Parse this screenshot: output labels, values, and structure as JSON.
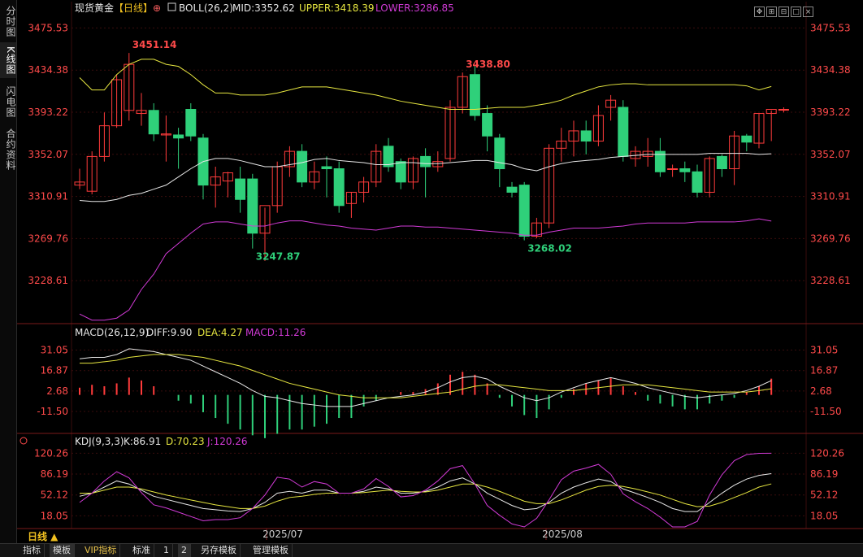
{
  "left_tabs": [
    {
      "label": "分时图",
      "active": false
    },
    {
      "label": "K线图",
      "active": true
    },
    {
      "label": "闪电图",
      "active": false
    },
    {
      "label": "合约资料",
      "active": false
    }
  ],
  "header": {
    "title": "现货黄金",
    "period_tag": "【日线】",
    "add_icon": "⊕",
    "boll_label": "BOLL(26,2)",
    "mid_label": "MID:3352.62",
    "upper_label": "UPPER:3418.39",
    "lower_label": "LOWER:3286.85"
  },
  "macd_header": {
    "name": "MACD(26,12,9)",
    "diff": "DIFF:9.90",
    "dea": "DEA:4.27",
    "macd": "MACD:11.26"
  },
  "kdj_header": {
    "name": "KDJ(9,3,3)",
    "k": "K:86.91",
    "d": "D:70.23",
    "j": "J:120.26"
  },
  "bottom": {
    "period_label": "日线 ▲",
    "buttons": [
      "指标",
      "模板",
      "VIP指标",
      "标准",
      "1",
      "2",
      "另存模板",
      "管理模板"
    ]
  },
  "colors": {
    "up": "#ff3b3b",
    "down": "#2fd07a",
    "mid": "#e8e8e8",
    "upper": "#e6e640",
    "lower": "#d13ad6",
    "axis_text": "#ff4a4a",
    "grid": "#3a0d0d"
  },
  "chart_data": [
    {
      "type": "candlestick",
      "title": "现货黄金【日线】",
      "y_ticks": [
        "3475.53",
        "3434.38",
        "3393.22",
        "3352.07",
        "3310.91",
        "3269.76",
        "3228.61"
      ],
      "ylim": [
        3189,
        3487
      ],
      "x_labels": [
        "2025/07",
        "2025/08"
      ],
      "annotations": [
        {
          "text": "3451.14",
          "color": "#ff4a4a",
          "bar": 4
        },
        {
          "text": "3438.80",
          "color": "#ff4a4a",
          "bar": 31
        },
        {
          "text": "3247.87",
          "color": "#2fd07a",
          "bar": 14
        },
        {
          "text": "3268.02",
          "color": "#2fd07a",
          "bar": 36
        }
      ],
      "candles": [
        {
          "o": 3322,
          "h": 3338,
          "l": 3318,
          "c": 3325
        },
        {
          "o": 3316,
          "h": 3355,
          "l": 3313,
          "c": 3350
        },
        {
          "o": 3350,
          "h": 3393,
          "l": 3345,
          "c": 3380
        },
        {
          "o": 3380,
          "h": 3430,
          "l": 3378,
          "c": 3425
        },
        {
          "o": 3395,
          "h": 3451.14,
          "l": 3385,
          "c": 3440
        },
        {
          "o": 3392,
          "h": 3412,
          "l": 3380,
          "c": 3395
        },
        {
          "o": 3395,
          "h": 3402,
          "l": 3365,
          "c": 3372
        },
        {
          "o": 3371,
          "h": 3390,
          "l": 3345,
          "c": 3372
        },
        {
          "o": 3371,
          "h": 3378,
          "l": 3338,
          "c": 3368
        },
        {
          "o": 3396,
          "h": 3402,
          "l": 3365,
          "c": 3370
        },
        {
          "o": 3368,
          "h": 3372,
          "l": 3308,
          "c": 3322
        },
        {
          "o": 3322,
          "h": 3340,
          "l": 3300,
          "c": 3330
        },
        {
          "o": 3326,
          "h": 3335,
          "l": 3310,
          "c": 3334
        },
        {
          "o": 3328,
          "h": 3340,
          "l": 3295,
          "c": 3308
        },
        {
          "o": 3328,
          "h": 3333,
          "l": 3260,
          "c": 3275
        },
        {
          "o": 3275,
          "h": 3300,
          "l": 3247.87,
          "c": 3302
        },
        {
          "o": 3302,
          "h": 3345,
          "l": 3295,
          "c": 3340
        },
        {
          "o": 3340,
          "h": 3360,
          "l": 3330,
          "c": 3355
        },
        {
          "o": 3355,
          "h": 3362,
          "l": 3320,
          "c": 3325
        },
        {
          "o": 3325,
          "h": 3345,
          "l": 3318,
          "c": 3335
        },
        {
          "o": 3340,
          "h": 3350,
          "l": 3310,
          "c": 3338
        },
        {
          "o": 3338,
          "h": 3345,
          "l": 3295,
          "c": 3302
        },
        {
          "o": 3304,
          "h": 3315,
          "l": 3290,
          "c": 3315
        },
        {
          "o": 3315,
          "h": 3330,
          "l": 3305,
          "c": 3325
        },
        {
          "o": 3325,
          "h": 3362,
          "l": 3320,
          "c": 3355
        },
        {
          "o": 3360,
          "h": 3368,
          "l": 3335,
          "c": 3340
        },
        {
          "o": 3345,
          "h": 3348,
          "l": 3318,
          "c": 3325
        },
        {
          "o": 3325,
          "h": 3350,
          "l": 3318,
          "c": 3348
        },
        {
          "o": 3350,
          "h": 3358,
          "l": 3310,
          "c": 3340
        },
        {
          "o": 3340,
          "h": 3355,
          "l": 3335,
          "c": 3345
        },
        {
          "o": 3348,
          "h": 3405,
          "l": 3345,
          "c": 3398
        },
        {
          "o": 3398,
          "h": 3432,
          "l": 3392,
          "c": 3428
        },
        {
          "o": 3430,
          "h": 3438.8,
          "l": 3385,
          "c": 3390
        },
        {
          "o": 3392,
          "h": 3400,
          "l": 3355,
          "c": 3370
        },
        {
          "o": 3368,
          "h": 3372,
          "l": 3320,
          "c": 3338
        },
        {
          "o": 3320,
          "h": 3325,
          "l": 3310,
          "c": 3315
        },
        {
          "o": 3322,
          "h": 3325,
          "l": 3268.02,
          "c": 3272
        },
        {
          "o": 3272,
          "h": 3290,
          "l": 3270,
          "c": 3285
        },
        {
          "o": 3285,
          "h": 3362,
          "l": 3280,
          "c": 3358
        },
        {
          "o": 3358,
          "h": 3378,
          "l": 3345,
          "c": 3365
        },
        {
          "o": 3365,
          "h": 3385,
          "l": 3350,
          "c": 3375
        },
        {
          "o": 3375,
          "h": 3385,
          "l": 3352,
          "c": 3365
        },
        {
          "o": 3365,
          "h": 3400,
          "l": 3360,
          "c": 3390
        },
        {
          "o": 3398,
          "h": 3410,
          "l": 3385,
          "c": 3405
        },
        {
          "o": 3398,
          "h": 3405,
          "l": 3345,
          "c": 3350
        },
        {
          "o": 3348,
          "h": 3360,
          "l": 3340,
          "c": 3355
        },
        {
          "o": 3350,
          "h": 3368,
          "l": 3340,
          "c": 3355
        },
        {
          "o": 3355,
          "h": 3368,
          "l": 3330,
          "c": 3335
        },
        {
          "o": 3338,
          "h": 3342,
          "l": 3330,
          "c": 3338
        },
        {
          "o": 3338,
          "h": 3345,
          "l": 3325,
          "c": 3335
        },
        {
          "o": 3335,
          "h": 3342,
          "l": 3310,
          "c": 3315
        },
        {
          "o": 3315,
          "h": 3350,
          "l": 3310,
          "c": 3348
        },
        {
          "o": 3350,
          "h": 3352,
          "l": 3330,
          "c": 3338
        },
        {
          "o": 3338,
          "h": 3375,
          "l": 3322,
          "c": 3370
        },
        {
          "o": 3370,
          "h": 3372,
          "l": 3355,
          "c": 3364
        },
        {
          "o": 3363,
          "h": 3392,
          "l": 3358,
          "c": 3392
        },
        {
          "o": 3392,
          "h": 3395,
          "l": 3365,
          "c": 3396
        },
        {
          "o": 3396,
          "h": 3398,
          "l": 3393,
          "c": 3396
        }
      ],
      "series": [
        {
          "name": "MID",
          "values": [
            3307,
            3306,
            3306,
            3308,
            3312,
            3314,
            3318,
            3322,
            3330,
            3338,
            3345,
            3348,
            3348,
            3346,
            3343,
            3340,
            3340,
            3342,
            3344,
            3347,
            3348,
            3346,
            3345,
            3344,
            3342,
            3342,
            3344,
            3344,
            3343,
            3343,
            3344,
            3345,
            3346,
            3346,
            3344,
            3342,
            3338,
            3336,
            3340,
            3343,
            3345,
            3346,
            3347,
            3349,
            3350,
            3351,
            3352,
            3352,
            3352,
            3352,
            3352,
            3353,
            3353,
            3353,
            3353,
            3352,
            3352.62
          ]
        },
        {
          "name": "UPPER",
          "values": [
            3427,
            3415,
            3415,
            3430,
            3440,
            3445,
            3445,
            3440,
            3438,
            3430,
            3420,
            3412,
            3412,
            3410,
            3410,
            3410,
            3412,
            3415,
            3418,
            3418,
            3418,
            3416,
            3414,
            3412,
            3410,
            3407,
            3404,
            3402,
            3400,
            3398,
            3396,
            3396,
            3396,
            3397,
            3398,
            3398,
            3398,
            3400,
            3402,
            3405,
            3410,
            3414,
            3418,
            3420,
            3421,
            3421,
            3420,
            3420,
            3420,
            3420,
            3420,
            3420,
            3420,
            3420,
            3419,
            3415,
            3418.39
          ]
        },
        {
          "name": "LOWER",
          "values": [
            3196,
            3190,
            3190,
            3192,
            3200,
            3220,
            3235,
            3255,
            3265,
            3275,
            3284,
            3286,
            3286,
            3284,
            3282,
            3282,
            3285,
            3287,
            3287,
            3285,
            3283,
            3282,
            3280,
            3279,
            3278,
            3280,
            3282,
            3282,
            3281,
            3281,
            3280,
            3279,
            3278,
            3277,
            3276,
            3275,
            3273,
            3273,
            3276,
            3278,
            3280,
            3280,
            3280,
            3281,
            3282,
            3284,
            3285,
            3285,
            3285,
            3285,
            3286,
            3286,
            3286,
            3286,
            3287,
            3289,
            3286.85
          ]
        }
      ]
    },
    {
      "type": "bar",
      "title": "MACD(26,12,9)",
      "y_ticks": [
        "31.05",
        "16.87",
        "2.68",
        "-11.50"
      ],
      "ylim": [
        -25,
        37
      ],
      "series": [
        {
          "name": "DIFF",
          "values": [
            25,
            26,
            26,
            28,
            32,
            31,
            30,
            28,
            26,
            24,
            20,
            16,
            12,
            8,
            3,
            -1,
            -2,
            -4,
            -6,
            -7,
            -8,
            -8,
            -8,
            -6,
            -4,
            -2,
            -1,
            0,
            2,
            5,
            9,
            12,
            13,
            11,
            6,
            2,
            -2,
            -4,
            -2,
            2,
            5,
            8,
            10,
            12,
            10,
            8,
            5,
            3,
            1,
            -1,
            -2,
            -1,
            0,
            1,
            3,
            6,
            9.9
          ]
        },
        {
          "name": "DEA",
          "values": [
            22,
            22,
            23,
            24,
            26,
            27,
            28,
            28,
            28,
            27,
            26,
            24,
            22,
            20,
            17,
            14,
            11,
            8,
            6,
            4,
            2,
            0,
            -1,
            -2,
            -2,
            -2,
            -2,
            -1,
            0,
            1,
            2,
            4,
            6,
            7,
            7,
            6,
            5,
            4,
            3,
            3,
            3,
            4,
            5,
            6,
            7,
            7,
            7,
            6,
            5,
            4,
            3,
            2,
            2,
            2,
            2,
            3,
            4.27
          ]
        },
        {
          "name": "MACD",
          "values": [
            5,
            7,
            6,
            8,
            12,
            10,
            6,
            0,
            -4,
            -6,
            -12,
            -16,
            -20,
            -24,
            -28,
            -30,
            -27,
            -24,
            -24,
            -22,
            -20,
            -16,
            -16,
            -8,
            -4,
            0,
            2,
            2,
            4,
            8,
            14,
            16,
            14,
            8,
            -2,
            -8,
            -14,
            -16,
            -10,
            -2,
            4,
            8,
            10,
            12,
            6,
            2,
            -4,
            -6,
            -8,
            -10,
            -10,
            -6,
            -4,
            -2,
            2,
            6,
            11.26
          ]
        }
      ]
    },
    {
      "type": "line",
      "title": "KDJ(9,3,3)",
      "y_ticks": [
        "120.26",
        "86.19",
        "52.12",
        "18.05"
      ],
      "ylim": [
        0,
        126
      ],
      "series": [
        {
          "name": "K",
          "values": [
            50,
            55,
            65,
            75,
            70,
            60,
            50,
            45,
            40,
            35,
            30,
            28,
            26,
            25,
            30,
            40,
            55,
            58,
            55,
            60,
            60,
            55,
            55,
            58,
            65,
            62,
            55,
            55,
            58,
            65,
            75,
            80,
            70,
            55,
            45,
            35,
            28,
            30,
            40,
            55,
            65,
            72,
            78,
            74,
            62,
            55,
            48,
            40,
            30,
            25,
            25,
            40,
            55,
            68,
            78,
            84,
            86.91
          ]
        },
        {
          "name": "D",
          "values": [
            55,
            55,
            60,
            65,
            65,
            62,
            57,
            52,
            48,
            44,
            40,
            36,
            33,
            30,
            30,
            34,
            42,
            48,
            50,
            53,
            55,
            55,
            55,
            56,
            58,
            60,
            58,
            57,
            57,
            60,
            65,
            70,
            70,
            65,
            58,
            50,
            42,
            38,
            38,
            44,
            52,
            60,
            66,
            68,
            66,
            62,
            57,
            52,
            45,
            38,
            33,
            34,
            40,
            48,
            56,
            65,
            70.23
          ]
        },
        {
          "name": "J",
          "values": [
            40,
            55,
            75,
            90,
            80,
            56,
            36,
            31,
            24,
            17,
            10,
            12,
            12,
            15,
            30,
            52,
            81,
            78,
            65,
            74,
            70,
            55,
            55,
            62,
            79,
            66,
            49,
            51,
            60,
            75,
            95,
            100,
            70,
            35,
            19,
            5,
            0,
            14,
            44,
            77,
            91,
            96,
            102,
            86,
            54,
            41,
            30,
            16,
            0,
            0,
            9,
            52,
            85,
            108,
            118,
            120,
            120.26
          ]
        }
      ]
    }
  ]
}
